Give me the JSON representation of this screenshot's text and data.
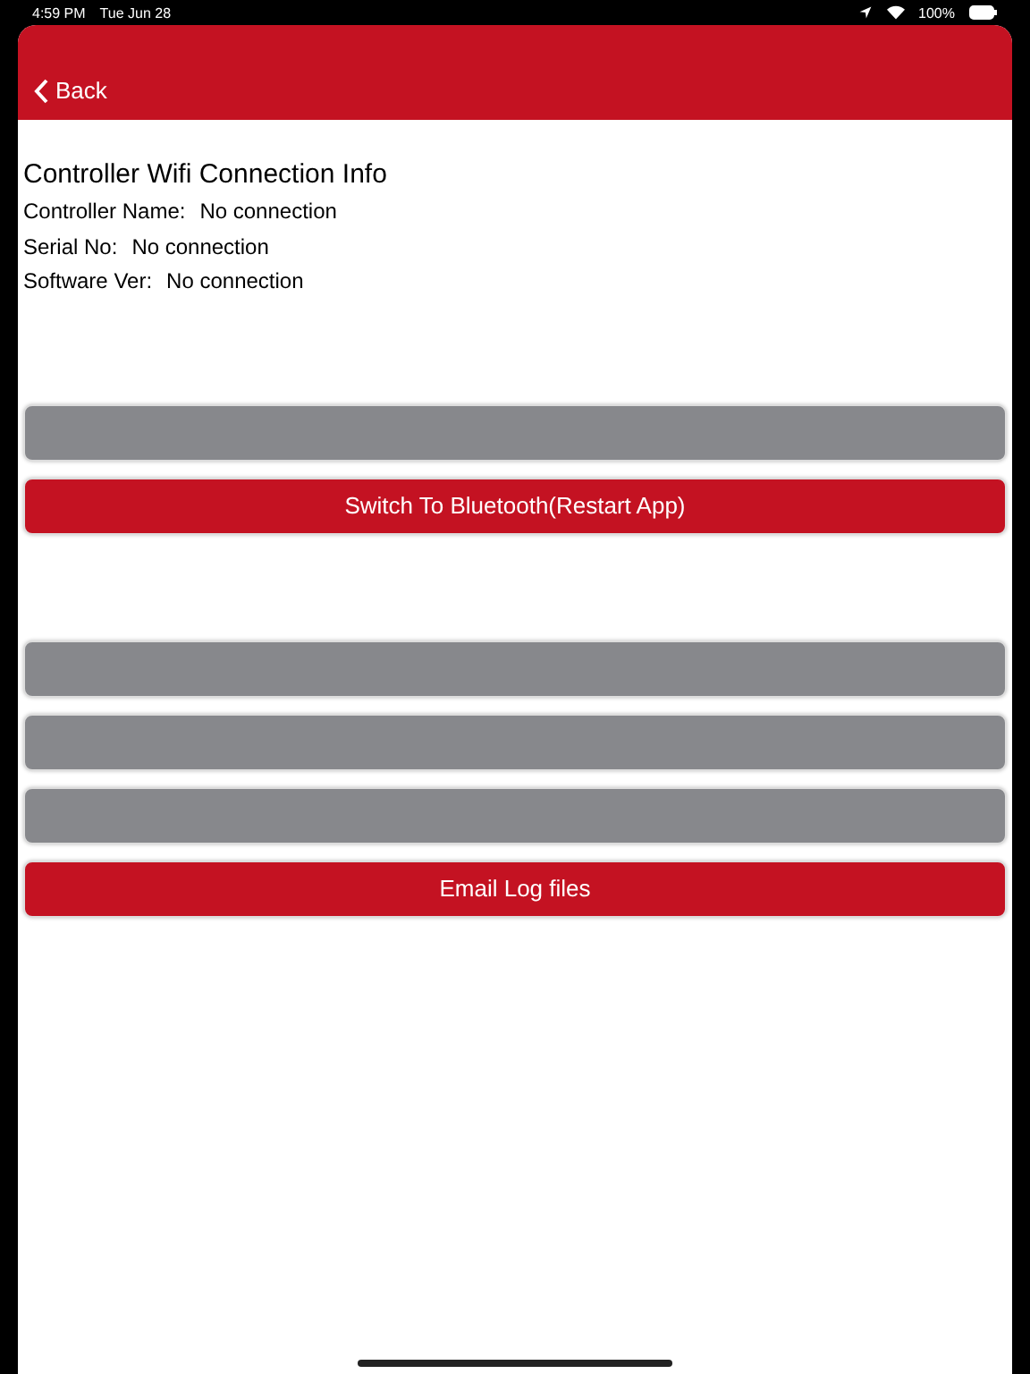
{
  "status_bar": {
    "time": "4:59 PM",
    "date": "Tue Jun 28",
    "battery": "100%"
  },
  "nav_bar": {
    "back_label": "Back"
  },
  "info": {
    "title": "Controller Wifi Connection Info",
    "fields": [
      {
        "label": "Controller Name:",
        "value": "No connection"
      },
      {
        "label": "Serial No:",
        "value": "No connection"
      },
      {
        "label": "Software Ver:",
        "value": "No connection"
      }
    ]
  },
  "button_groups": [
    [
      {
        "disabled": true
      },
      {
        "label": "Switch To Bluetooth(Restart App)",
        "disabled": false
      }
    ],
    [
      {
        "disabled": true
      },
      {
        "disabled": true
      },
      {
        "disabled": true
      },
      {
        "label": "Email Log files",
        "disabled": false
      }
    ]
  ]
}
